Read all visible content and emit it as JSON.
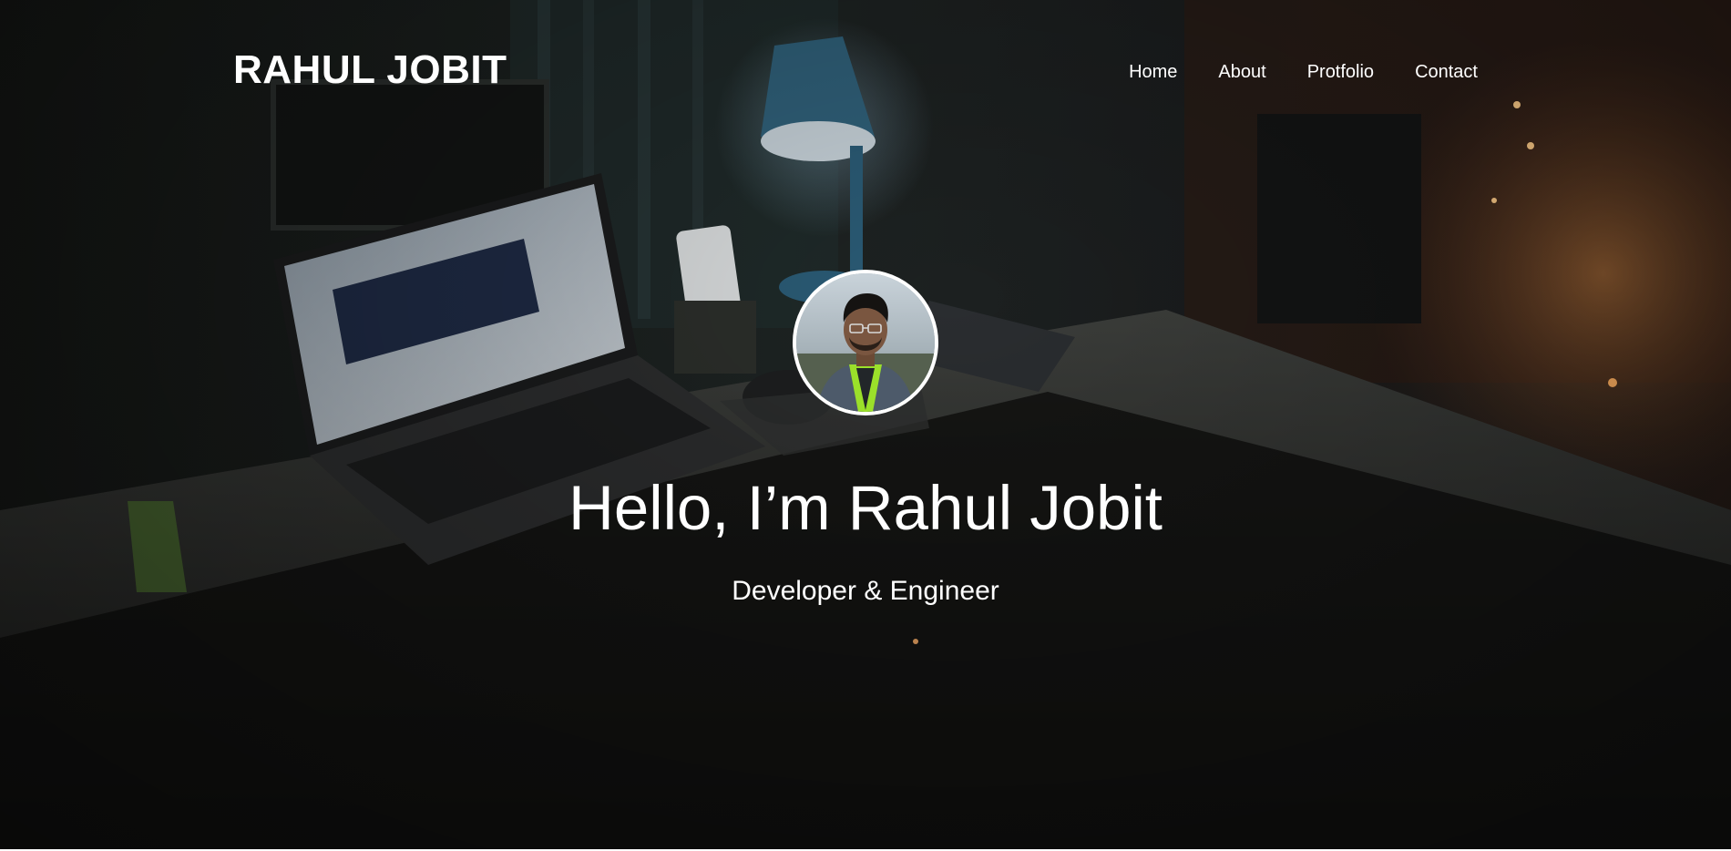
{
  "header": {
    "brand": "RAHUL JOBIT",
    "nav": [
      {
        "label": "Home"
      },
      {
        "label": "About"
      },
      {
        "label": "Protfolio"
      },
      {
        "label": "Contact"
      }
    ]
  },
  "hero": {
    "avatar_icon": "profile-photo",
    "title": "Hello, I’m Rahul Jobit",
    "subtitle": "Developer & Engineer"
  },
  "colors": {
    "text": "#ffffff",
    "background": "#0c0c0b"
  }
}
